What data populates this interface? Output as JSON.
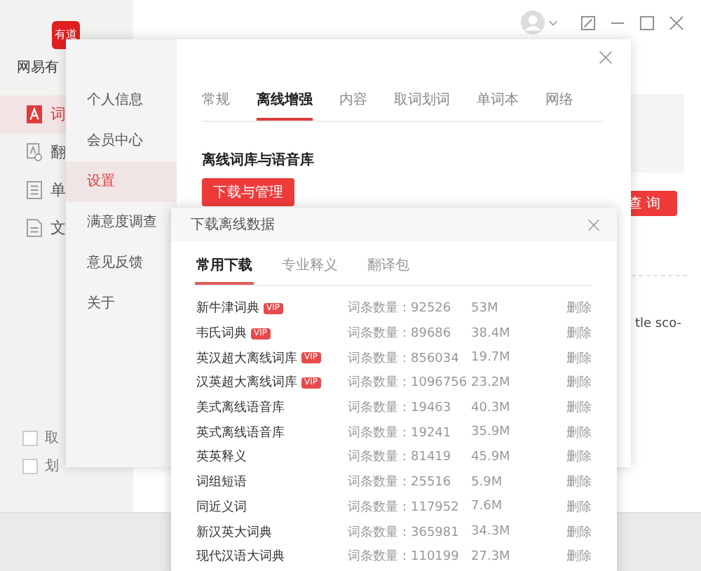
{
  "app": {
    "logo_text": "有道",
    "name": "网易有",
    "nav": [
      {
        "label": "词",
        "kind": "dict",
        "selected": true
      },
      {
        "label": "翻",
        "kind": "translate",
        "selected": false
      },
      {
        "label": "单",
        "kind": "book",
        "selected": false
      },
      {
        "label": "文",
        "kind": "doc",
        "selected": false
      }
    ],
    "options": [
      {
        "label": "取",
        "checked": false
      },
      {
        "label": "划",
        "checked": false
      }
    ],
    "search_button": "查 询",
    "snippet": "tle sco-"
  },
  "settings": {
    "menu": [
      {
        "label": "个人信息",
        "selected": false
      },
      {
        "label": "会员中心",
        "selected": false
      },
      {
        "label": "设置",
        "selected": true
      },
      {
        "label": "满意度调查",
        "selected": false
      },
      {
        "label": "意见反馈",
        "selected": false
      },
      {
        "label": "关于",
        "selected": false
      }
    ],
    "tabs": [
      {
        "label": "常规",
        "selected": false
      },
      {
        "label": "离线增强",
        "selected": true
      },
      {
        "label": "内容",
        "selected": false
      },
      {
        "label": "取词划词",
        "selected": false
      },
      {
        "label": "单词本",
        "selected": false
      },
      {
        "label": "网络",
        "selected": false
      }
    ],
    "section_title": "离线词库与语音库",
    "button": "下载与管理"
  },
  "download": {
    "title": "下载离线数据",
    "tabs": [
      {
        "label": "常用下载",
        "selected": true
      },
      {
        "label": "专业释义",
        "selected": false
      },
      {
        "label": "翻译包",
        "selected": false
      }
    ],
    "rows": [
      {
        "name": "新牛津词典",
        "badge": "VIP",
        "count": "词条数量：92526",
        "size": "53M",
        "action": "删除"
      },
      {
        "name": "韦氏词典",
        "badge": "VIP",
        "count": "词条数量：89686",
        "size": "38.4M",
        "action": "删除"
      },
      {
        "name": "英汉超大离线词库",
        "badge": "VIP",
        "count": "词条数量：856034",
        "size": "19.7M",
        "action": "删除"
      },
      {
        "name": "汉英超大离线词库",
        "badge": "VIP",
        "count": "词条数量：1096756",
        "size": "23.2M",
        "action": "删除"
      },
      {
        "name": "美式离线语音库",
        "count": "词条数量：19463",
        "size": "40.3M",
        "action": "删除"
      },
      {
        "name": "英式离线语音库",
        "count": "词条数量：19241",
        "size": "35.9M",
        "action": "删除"
      },
      {
        "name": "英英释义",
        "count": "词条数量：81419",
        "size": "45.9M",
        "action": "删除"
      },
      {
        "name": "词组短语",
        "count": "词条数量：25516",
        "size": "5.9M",
        "action": "删除"
      },
      {
        "name": "同近义词",
        "count": "词条数量：117952",
        "size": "7.6M",
        "action": "删除"
      },
      {
        "name": "新汉英大词典",
        "count": "词条数量：365981",
        "size": "34.3M",
        "action": "删除"
      },
      {
        "name": "现代汉语大词典",
        "count": "词条数量：110199",
        "size": "27.3M",
        "action": "删除"
      }
    ]
  }
}
